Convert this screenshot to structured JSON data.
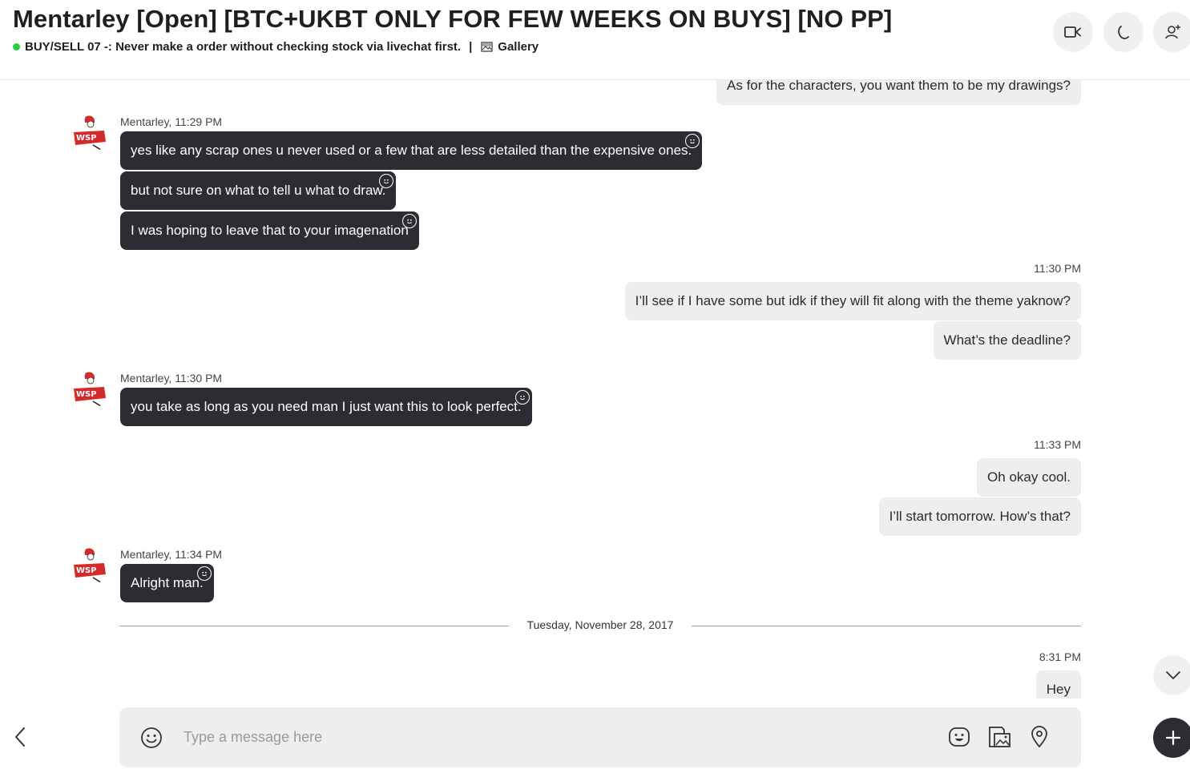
{
  "header": {
    "title": "Mentarley [Open] [BTC+UKBT ONLY FOR FEW WEEKS ON BUYS] [NO PP]",
    "status_text": "BUY/SELL 07 -: Never make a order without checking stock via livechat first.",
    "separator": "|",
    "gallery_label": "Gallery",
    "status_color": "#2ecc40"
  },
  "messages": [
    {
      "side": "out",
      "text": "As for the characters, you want them to be my drawings?"
    },
    {
      "side": "in",
      "meta": "Mentarley, 11:29 PM",
      "bubbles": [
        "yes like any scrap ones u never used or a few that are less detailed than the expensive ones.",
        "but not sure on what to tell u what to draw.",
        "I was hoping to leave that to your imagenation"
      ]
    },
    {
      "side": "out",
      "meta": "11:30 PM",
      "bubbles": [
        "I’ll see if I have some but idk if they will fit along with the theme yaknow?",
        "What’s the deadline?"
      ]
    },
    {
      "side": "in",
      "meta": "Mentarley, 11:30 PM",
      "bubbles": [
        "you take as long as you need man I just want this to look perfect."
      ]
    },
    {
      "side": "out",
      "meta": "11:33 PM",
      "bubbles": [
        "Oh okay cool.",
        "I’ll start tomorrow. How’s that?"
      ]
    },
    {
      "side": "in",
      "meta": "Mentarley, 11:34 PM",
      "bubbles": [
        "Alright man."
      ]
    },
    {
      "date": "Tuesday, November 28, 2017"
    },
    {
      "side": "out",
      "meta": "8:31 PM",
      "bubbles": [
        "Hey"
      ]
    }
  ],
  "composer": {
    "placeholder": "Type a message here"
  },
  "colors": {
    "incoming_bubble": "#2b2d33",
    "outgoing_bubble": "#eeeef0",
    "avatar_accent": "#d62a2a"
  },
  "icons": {
    "header_buttons": [
      "video-call-icon",
      "audio-call-icon",
      "add-people-icon"
    ],
    "composer": [
      "emoji-icon",
      "sticker-icon",
      "media-gallery-icon",
      "location-icon"
    ],
    "other": [
      "back-chevron-icon",
      "scroll-down-chevron-icon",
      "plus-icon"
    ]
  }
}
